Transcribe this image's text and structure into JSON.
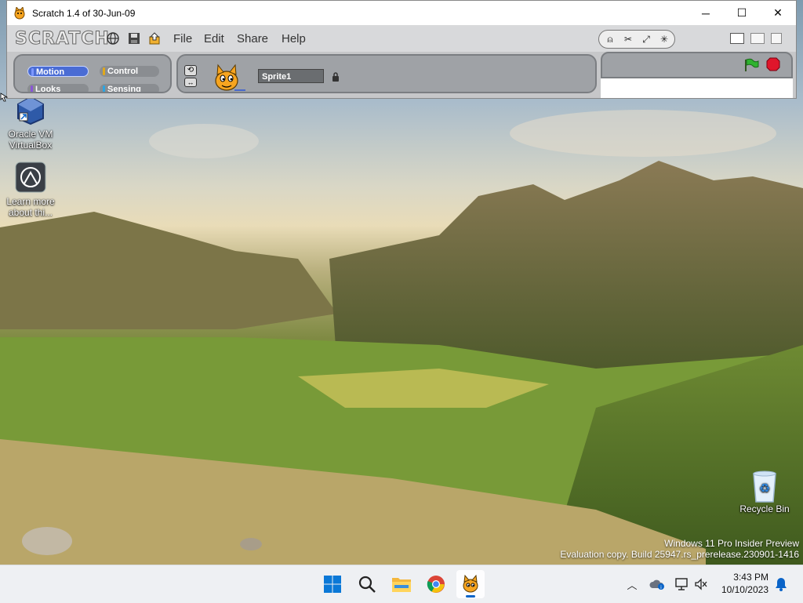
{
  "window": {
    "title": "Scratch 1.4 of 30-Jun-09",
    "controls": {
      "minimize": "─",
      "maximize": "☐",
      "close": "✕"
    }
  },
  "scratch": {
    "logo": "SCRATCH",
    "menu": [
      "File",
      "Edit",
      "Share",
      "Help"
    ],
    "categories": {
      "motion": {
        "label": "Motion",
        "color": "#4a6cd4"
      },
      "control": {
        "label": "Control",
        "color": "#e1a91a"
      },
      "looks": {
        "label": "Looks",
        "color": "#8a55d7"
      },
      "sensing": {
        "label": "Sensing",
        "color": "#2ca5e2"
      }
    },
    "sprite_name": "Sprite1"
  },
  "desktop": {
    "icons": [
      {
        "label_line1": "Oracle VM",
        "label_line2": "VirtualBox"
      },
      {
        "label_line1": "Learn more",
        "label_line2": "about thi..."
      },
      {
        "label_line1": "Recycle Bin",
        "label_line2": ""
      }
    ],
    "watermark_line1": "Windows 11 Pro Insider Preview",
    "watermark_line2": "Evaluation copy. Build 25947.rs_prerelease.230901-1416"
  },
  "taskbar": {
    "time": "3:43 PM",
    "date": "10/10/2023",
    "accent": "#0a64c8"
  }
}
